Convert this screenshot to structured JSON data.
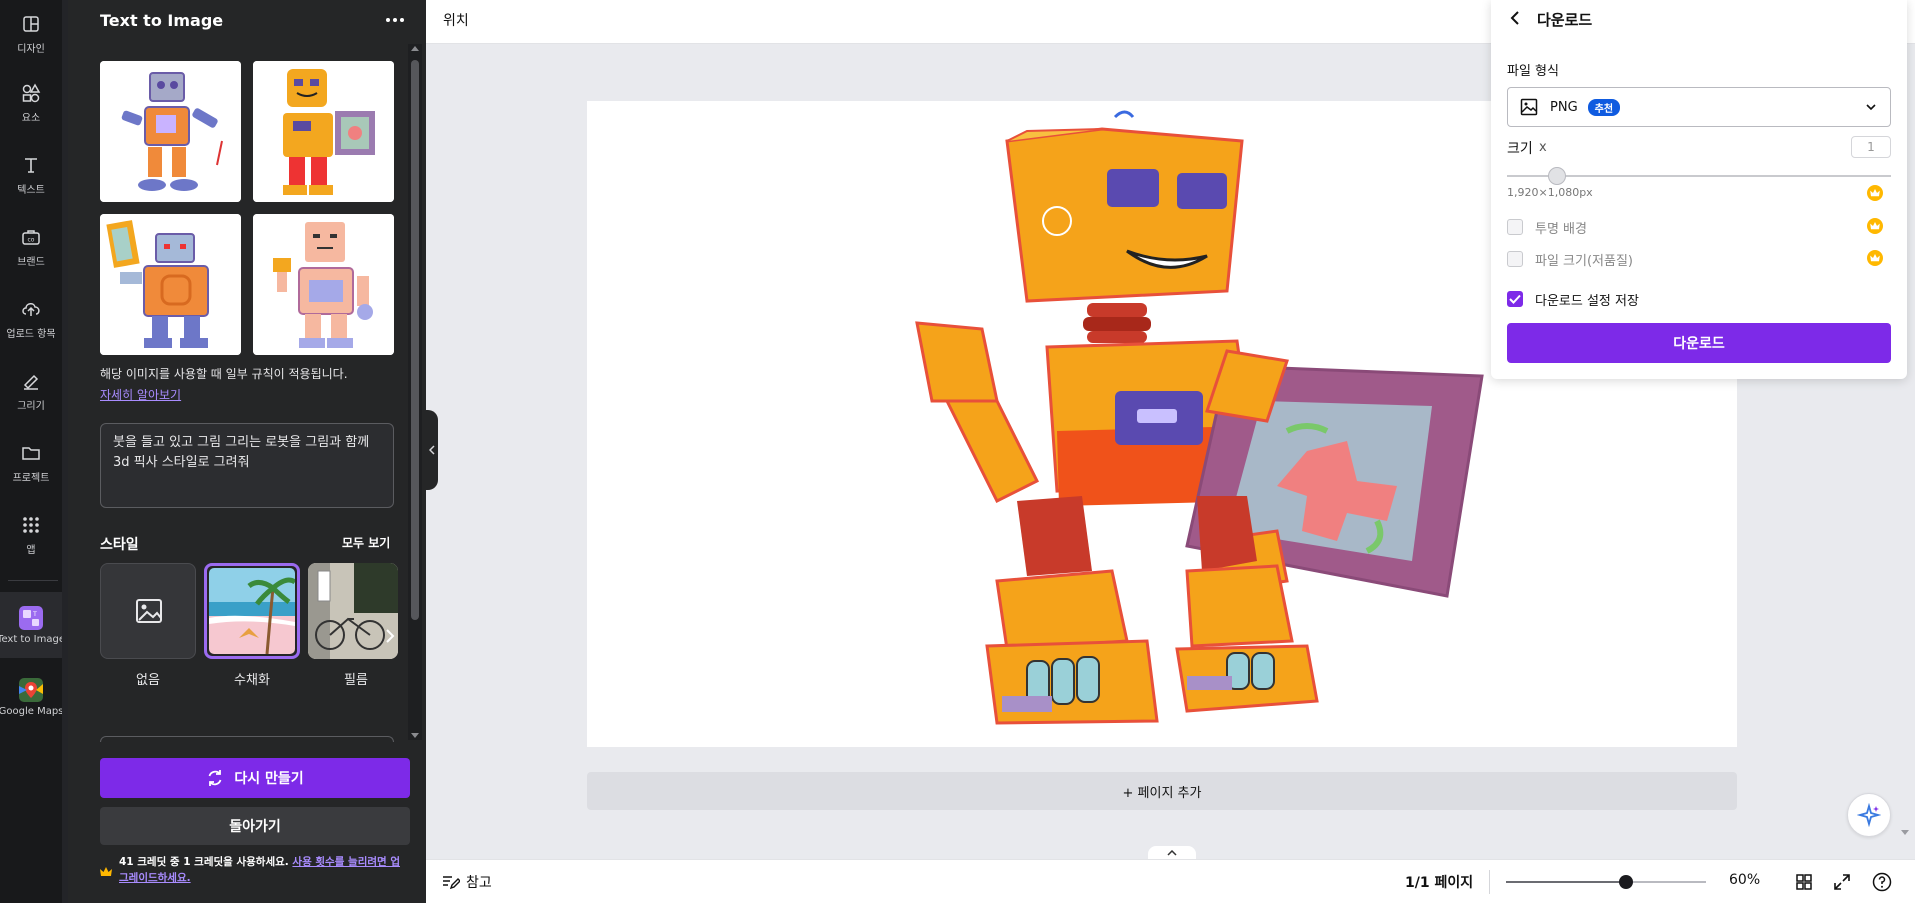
{
  "rail": {
    "items": [
      {
        "label": "디자인",
        "icon": "design-icon"
      },
      {
        "label": "요소",
        "icon": "elements-icon"
      },
      {
        "label": "텍스트",
        "icon": "text-icon"
      },
      {
        "label": "브랜드",
        "icon": "brand-icon"
      },
      {
        "label": "업로드 항목",
        "icon": "upload-icon"
      },
      {
        "label": "그리기",
        "icon": "draw-icon"
      },
      {
        "label": "프로젝트",
        "icon": "folder-icon"
      },
      {
        "label": "앱",
        "icon": "apps-icon"
      },
      {
        "label": "Text to Image",
        "icon": "text-to-image-icon"
      },
      {
        "label": "Google Maps",
        "icon": "google-maps-icon"
      }
    ]
  },
  "panel": {
    "title": "Text to Image",
    "rule_text": "해당 이미지를 사용할 때 일부 규칙이 적용됩니다.",
    "rule_link": "자세히 알아보기",
    "prompt": "붓을 들고 있고 그림 그리는 로봇을 그림과 함께 3d 픽사 스타일로 그려줘",
    "style_header": "스타일",
    "style_see_all": "모두 보기",
    "styles": [
      {
        "label": "없음"
      },
      {
        "label": "수채화"
      },
      {
        "label": "필름"
      }
    ],
    "regenerate_label": "다시 만들기",
    "back_label": "돌아가기",
    "credit_text": "41 크레딧 중 1 크레딧을 사용하세요.",
    "credit_link": "사용 횟수를 늘리려면 업그레이드하세요."
  },
  "topbar": {
    "position_label": "위치"
  },
  "canvas": {
    "add_page_label": "+ 페이지 추가"
  },
  "bottombar": {
    "notes_label": "참고",
    "page_indicator": "1/1 페이지",
    "zoom_label": "60%",
    "zoom_fraction": 0.6
  },
  "download": {
    "title": "다운로드",
    "file_type_label": "파일 형식",
    "file_type_value": "PNG",
    "recommended_badge": "추천",
    "size_label": "크기",
    "size_x": "x",
    "size_value": "1",
    "size_slider_fraction": 0.13,
    "dimensions": "1,920×1,080px",
    "transparent_bg_label": "투명 배경",
    "compress_label": "파일 크기(저품질)",
    "save_settings_label": "다운로드 설정 저장",
    "save_settings_checked": true,
    "download_button": "다운로드"
  },
  "colors": {
    "accent": "#7d2ae8",
    "badge_blue": "#0f5be0",
    "crown_gold": "#ffb800",
    "panel_bg": "#252627",
    "rail_bg": "#18191b"
  }
}
